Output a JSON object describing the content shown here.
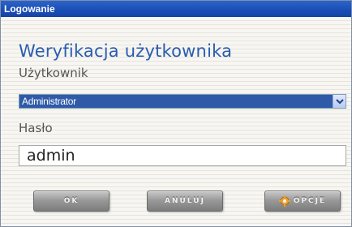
{
  "window": {
    "title": "Logowanie"
  },
  "form": {
    "heading": "Weryfikacja użytkownika",
    "user_label": "Użytkownik",
    "user_selected": "Administrator",
    "password_label": "Hasło",
    "password_value": "admin"
  },
  "buttons": {
    "ok": "OK",
    "cancel": "ANULUJ",
    "options": "OPCJE"
  },
  "colors": {
    "titlebar": "#1a4fb8",
    "heading": "#2a5db0",
    "selection": "#2f5aa8"
  },
  "icons": {
    "dropdown": "chevron-down-icon",
    "options": "gear-icon"
  }
}
